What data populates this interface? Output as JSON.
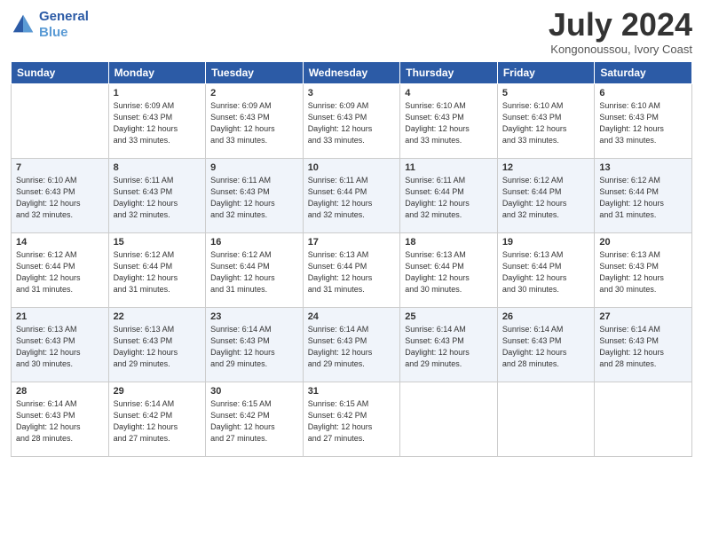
{
  "logo": {
    "line1": "General",
    "line2": "Blue"
  },
  "title": "July 2024",
  "location": "Kongonoussou, Ivory Coast",
  "days_of_week": [
    "Sunday",
    "Monday",
    "Tuesday",
    "Wednesday",
    "Thursday",
    "Friday",
    "Saturday"
  ],
  "weeks": [
    [
      {
        "day": "",
        "sunrise": "",
        "sunset": "",
        "daylight": ""
      },
      {
        "day": "1",
        "sunrise": "Sunrise: 6:09 AM",
        "sunset": "Sunset: 6:43 PM",
        "daylight": "Daylight: 12 hours and 33 minutes."
      },
      {
        "day": "2",
        "sunrise": "Sunrise: 6:09 AM",
        "sunset": "Sunset: 6:43 PM",
        "daylight": "Daylight: 12 hours and 33 minutes."
      },
      {
        "day": "3",
        "sunrise": "Sunrise: 6:09 AM",
        "sunset": "Sunset: 6:43 PM",
        "daylight": "Daylight: 12 hours and 33 minutes."
      },
      {
        "day": "4",
        "sunrise": "Sunrise: 6:10 AM",
        "sunset": "Sunset: 6:43 PM",
        "daylight": "Daylight: 12 hours and 33 minutes."
      },
      {
        "day": "5",
        "sunrise": "Sunrise: 6:10 AM",
        "sunset": "Sunset: 6:43 PM",
        "daylight": "Daylight: 12 hours and 33 minutes."
      },
      {
        "day": "6",
        "sunrise": "Sunrise: 6:10 AM",
        "sunset": "Sunset: 6:43 PM",
        "daylight": "Daylight: 12 hours and 33 minutes."
      }
    ],
    [
      {
        "day": "7",
        "sunrise": "Sunrise: 6:10 AM",
        "sunset": "Sunset: 6:43 PM",
        "daylight": "Daylight: 12 hours and 32 minutes."
      },
      {
        "day": "8",
        "sunrise": "Sunrise: 6:11 AM",
        "sunset": "Sunset: 6:43 PM",
        "daylight": "Daylight: 12 hours and 32 minutes."
      },
      {
        "day": "9",
        "sunrise": "Sunrise: 6:11 AM",
        "sunset": "Sunset: 6:43 PM",
        "daylight": "Daylight: 12 hours and 32 minutes."
      },
      {
        "day": "10",
        "sunrise": "Sunrise: 6:11 AM",
        "sunset": "Sunset: 6:44 PM",
        "daylight": "Daylight: 12 hours and 32 minutes."
      },
      {
        "day": "11",
        "sunrise": "Sunrise: 6:11 AM",
        "sunset": "Sunset: 6:44 PM",
        "daylight": "Daylight: 12 hours and 32 minutes."
      },
      {
        "day": "12",
        "sunrise": "Sunrise: 6:12 AM",
        "sunset": "Sunset: 6:44 PM",
        "daylight": "Daylight: 12 hours and 32 minutes."
      },
      {
        "day": "13",
        "sunrise": "Sunrise: 6:12 AM",
        "sunset": "Sunset: 6:44 PM",
        "daylight": "Daylight: 12 hours and 31 minutes."
      }
    ],
    [
      {
        "day": "14",
        "sunrise": "Sunrise: 6:12 AM",
        "sunset": "Sunset: 6:44 PM",
        "daylight": "Daylight: 12 hours and 31 minutes."
      },
      {
        "day": "15",
        "sunrise": "Sunrise: 6:12 AM",
        "sunset": "Sunset: 6:44 PM",
        "daylight": "Daylight: 12 hours and 31 minutes."
      },
      {
        "day": "16",
        "sunrise": "Sunrise: 6:12 AM",
        "sunset": "Sunset: 6:44 PM",
        "daylight": "Daylight: 12 hours and 31 minutes."
      },
      {
        "day": "17",
        "sunrise": "Sunrise: 6:13 AM",
        "sunset": "Sunset: 6:44 PM",
        "daylight": "Daylight: 12 hours and 31 minutes."
      },
      {
        "day": "18",
        "sunrise": "Sunrise: 6:13 AM",
        "sunset": "Sunset: 6:44 PM",
        "daylight": "Daylight: 12 hours and 30 minutes."
      },
      {
        "day": "19",
        "sunrise": "Sunrise: 6:13 AM",
        "sunset": "Sunset: 6:44 PM",
        "daylight": "Daylight: 12 hours and 30 minutes."
      },
      {
        "day": "20",
        "sunrise": "Sunrise: 6:13 AM",
        "sunset": "Sunset: 6:43 PM",
        "daylight": "Daylight: 12 hours and 30 minutes."
      }
    ],
    [
      {
        "day": "21",
        "sunrise": "Sunrise: 6:13 AM",
        "sunset": "Sunset: 6:43 PM",
        "daylight": "Daylight: 12 hours and 30 minutes."
      },
      {
        "day": "22",
        "sunrise": "Sunrise: 6:13 AM",
        "sunset": "Sunset: 6:43 PM",
        "daylight": "Daylight: 12 hours and 29 minutes."
      },
      {
        "day": "23",
        "sunrise": "Sunrise: 6:14 AM",
        "sunset": "Sunset: 6:43 PM",
        "daylight": "Daylight: 12 hours and 29 minutes."
      },
      {
        "day": "24",
        "sunrise": "Sunrise: 6:14 AM",
        "sunset": "Sunset: 6:43 PM",
        "daylight": "Daylight: 12 hours and 29 minutes."
      },
      {
        "day": "25",
        "sunrise": "Sunrise: 6:14 AM",
        "sunset": "Sunset: 6:43 PM",
        "daylight": "Daylight: 12 hours and 29 minutes."
      },
      {
        "day": "26",
        "sunrise": "Sunrise: 6:14 AM",
        "sunset": "Sunset: 6:43 PM",
        "daylight": "Daylight: 12 hours and 28 minutes."
      },
      {
        "day": "27",
        "sunrise": "Sunrise: 6:14 AM",
        "sunset": "Sunset: 6:43 PM",
        "daylight": "Daylight: 12 hours and 28 minutes."
      }
    ],
    [
      {
        "day": "28",
        "sunrise": "Sunrise: 6:14 AM",
        "sunset": "Sunset: 6:43 PM",
        "daylight": "Daylight: 12 hours and 28 minutes."
      },
      {
        "day": "29",
        "sunrise": "Sunrise: 6:14 AM",
        "sunset": "Sunset: 6:42 PM",
        "daylight": "Daylight: 12 hours and 27 minutes."
      },
      {
        "day": "30",
        "sunrise": "Sunrise: 6:15 AM",
        "sunset": "Sunset: 6:42 PM",
        "daylight": "Daylight: 12 hours and 27 minutes."
      },
      {
        "day": "31",
        "sunrise": "Sunrise: 6:15 AM",
        "sunset": "Sunset: 6:42 PM",
        "daylight": "Daylight: 12 hours and 27 minutes."
      },
      {
        "day": "",
        "sunrise": "",
        "sunset": "",
        "daylight": ""
      },
      {
        "day": "",
        "sunrise": "",
        "sunset": "",
        "daylight": ""
      },
      {
        "day": "",
        "sunrise": "",
        "sunset": "",
        "daylight": ""
      }
    ]
  ]
}
